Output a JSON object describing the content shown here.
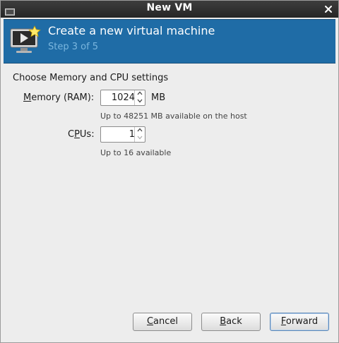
{
  "window": {
    "title": "New VM"
  },
  "banner": {
    "title": "Create a new virtual machine",
    "step": "Step 3 of 5"
  },
  "section": {
    "title": "Choose Memory and CPU settings"
  },
  "memory": {
    "label_prefix": "",
    "label_mnemonic": "M",
    "label_rest": "emory (RAM):",
    "value": "1024",
    "unit": "MB",
    "hint": "Up to 48251 MB available on the host"
  },
  "cpus": {
    "label_prefix": "C",
    "label_mnemonic": "P",
    "label_rest": "Us:",
    "value": "1",
    "hint": "Up to 16 available"
  },
  "buttons": {
    "cancel": {
      "mnemonic": "C",
      "rest": "ancel"
    },
    "back": {
      "mnemonic": "B",
      "rest": "ack"
    },
    "forward": {
      "mnemonic": "F",
      "rest": "orward"
    }
  },
  "colors": {
    "banner_bg": "#1f6ca6",
    "banner_step_text": "#7ab6de",
    "titlebar_bg": "#2e2e2e"
  },
  "icons": {
    "window": "vm-window-icon",
    "close": "close-icon",
    "banner": "monitor-play-icon",
    "spin_up": "chevron-up-icon",
    "spin_down": "chevron-down-icon"
  }
}
